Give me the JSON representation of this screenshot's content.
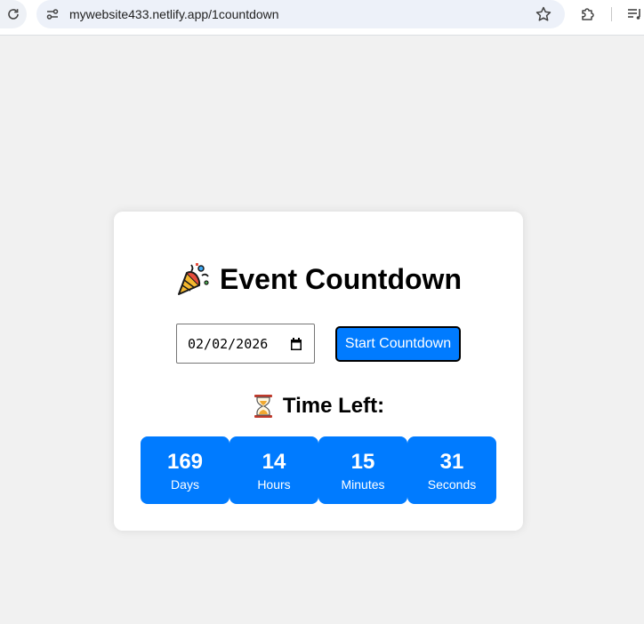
{
  "browser": {
    "url": "mywebsite433.netlify.app/1countdown"
  },
  "page": {
    "title": "Event Countdown",
    "title_icon": "party-popper-icon",
    "date_value": "02/02/2026",
    "start_button_label": "Start Countdown",
    "time_left_label": "Time Left:",
    "time_left_icon": "hourglass-icon"
  },
  "countdown": {
    "days": {
      "value": "169",
      "label": "Days"
    },
    "hours": {
      "value": "14",
      "label": "Hours"
    },
    "minutes": {
      "value": "15",
      "label": "Minutes"
    },
    "seconds": {
      "value": "31",
      "label": "Seconds"
    }
  },
  "colors": {
    "accent": "#007bff",
    "background": "#f1f1f1",
    "card": "#ffffff"
  }
}
